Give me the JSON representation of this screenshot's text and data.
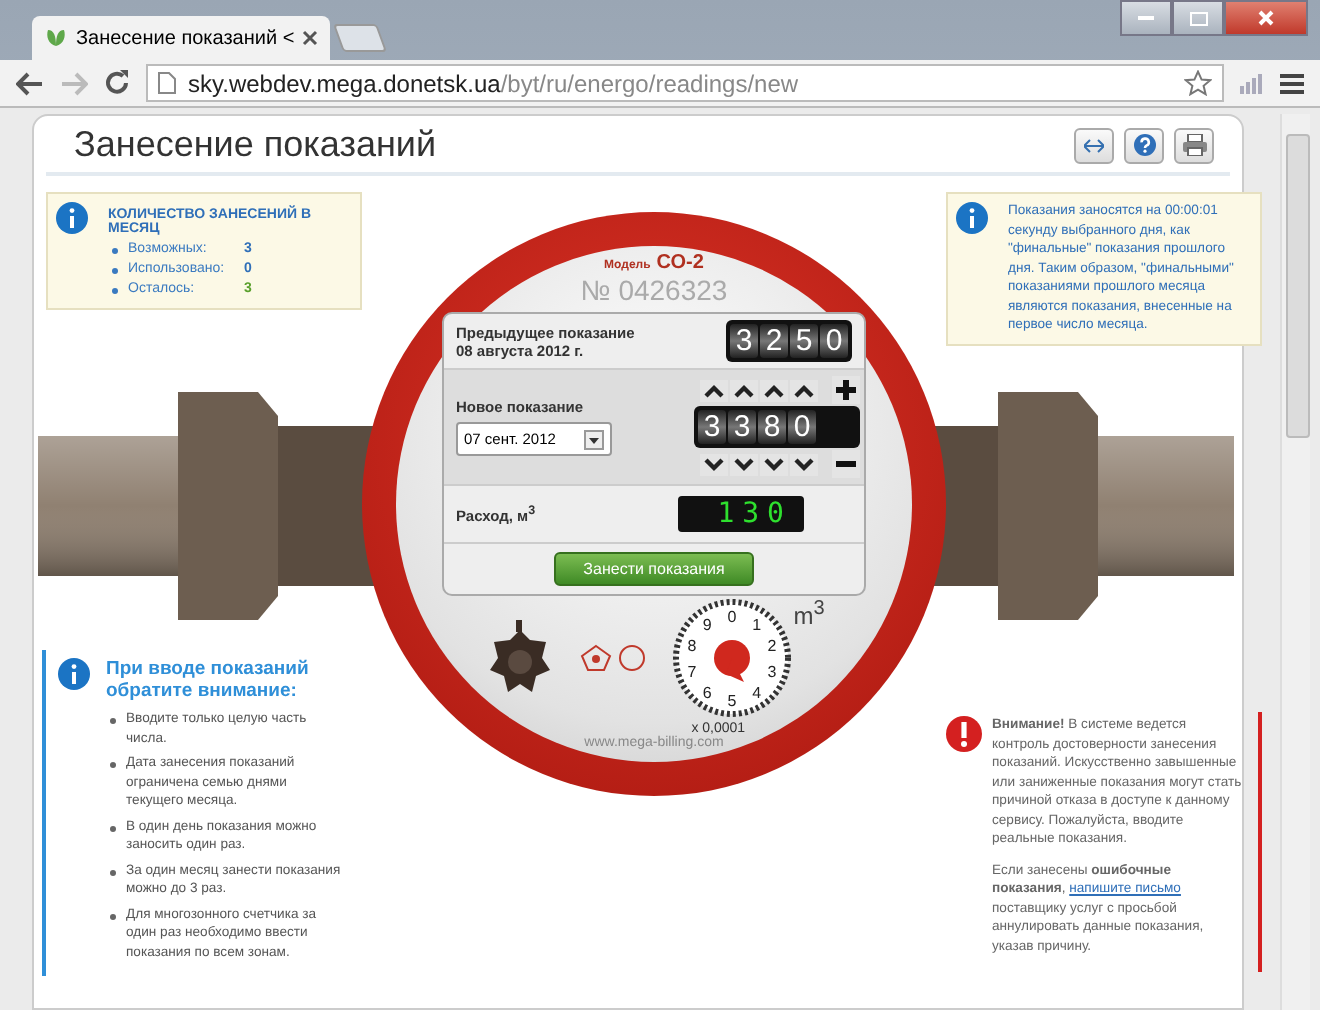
{
  "browser": {
    "tab_title": "Занесение показаний < ",
    "url_host": "sky.webdev.mega.donetsk.ua",
    "url_path": "/byt/ru/energo/readings/new"
  },
  "page": {
    "title": "Занесение показаний"
  },
  "count_box": {
    "heading": "КОЛИЧЕСТВО ЗАНЕСЕНИЙ В МЕСЯЦ",
    "items": [
      {
        "label": "Возможных:",
        "value": "3",
        "color": "#2f6fb8"
      },
      {
        "label": "Использовано:",
        "value": "0",
        "color": "#2f6fb8"
      },
      {
        "label": "Осталось:",
        "value": "3",
        "color": "#5aa02c"
      }
    ]
  },
  "info_note": "Показания заносятся на 00:00:01 секунду выбранного дня, как \"финальные\" показания прошлого дня. Таким образом, \"финальными\" показаниями прошлого месяца являются показания, внесенные на первое число месяца.",
  "meter": {
    "model_label": "Модель",
    "model": "СО-2",
    "serial": "№ 0426323",
    "previous": {
      "label": "Предыдущее показание",
      "date": "08 августа 2012 г.",
      "digits": [
        "3",
        "2",
        "5",
        "0"
      ]
    },
    "new": {
      "label": "Новое показание",
      "date": "07 сент. 2012",
      "digits": [
        "3",
        "3",
        "8",
        "0"
      ]
    },
    "consumption": {
      "label": "Расход, м$^{3}$",
      "value": "130"
    },
    "submit": "Занести показания",
    "dial_numbers": [
      "0",
      "1",
      "2",
      "3",
      "4",
      "5",
      "6",
      "7",
      "8",
      "9"
    ],
    "dial_unit": "m$^{3}$",
    "dial_factor": "x 0,0001",
    "website": "www.mega-billing.com"
  },
  "notice": {
    "title": "При вводе показаний обратите внимание:",
    "items": [
      "Вводите только целую часть числа.",
      "Дата занесения показаний ограничена семью днями текущего месяца.",
      "В один день показания можно заносить один раз.",
      "За один месяц занести показания можно до 3 раз.",
      "Для многозонного счетчика за один раз необходимо ввести показания по всем зонам."
    ]
  },
  "warning": {
    "text": "**Внимание!** В системе ведется контроль достоверности занесения показаний. Искусственно завышенные или заниженные показания могут стать причиной отказа в доступе к данному сервису. Пожалуйста, вводите реальные показания.",
    "second_before": "Если занесены **ошибочные показания**, ",
    "link": "напишите письмо",
    "second_after": " поставщику услуг с просьбой аннулировать данные показания, указав причину."
  }
}
